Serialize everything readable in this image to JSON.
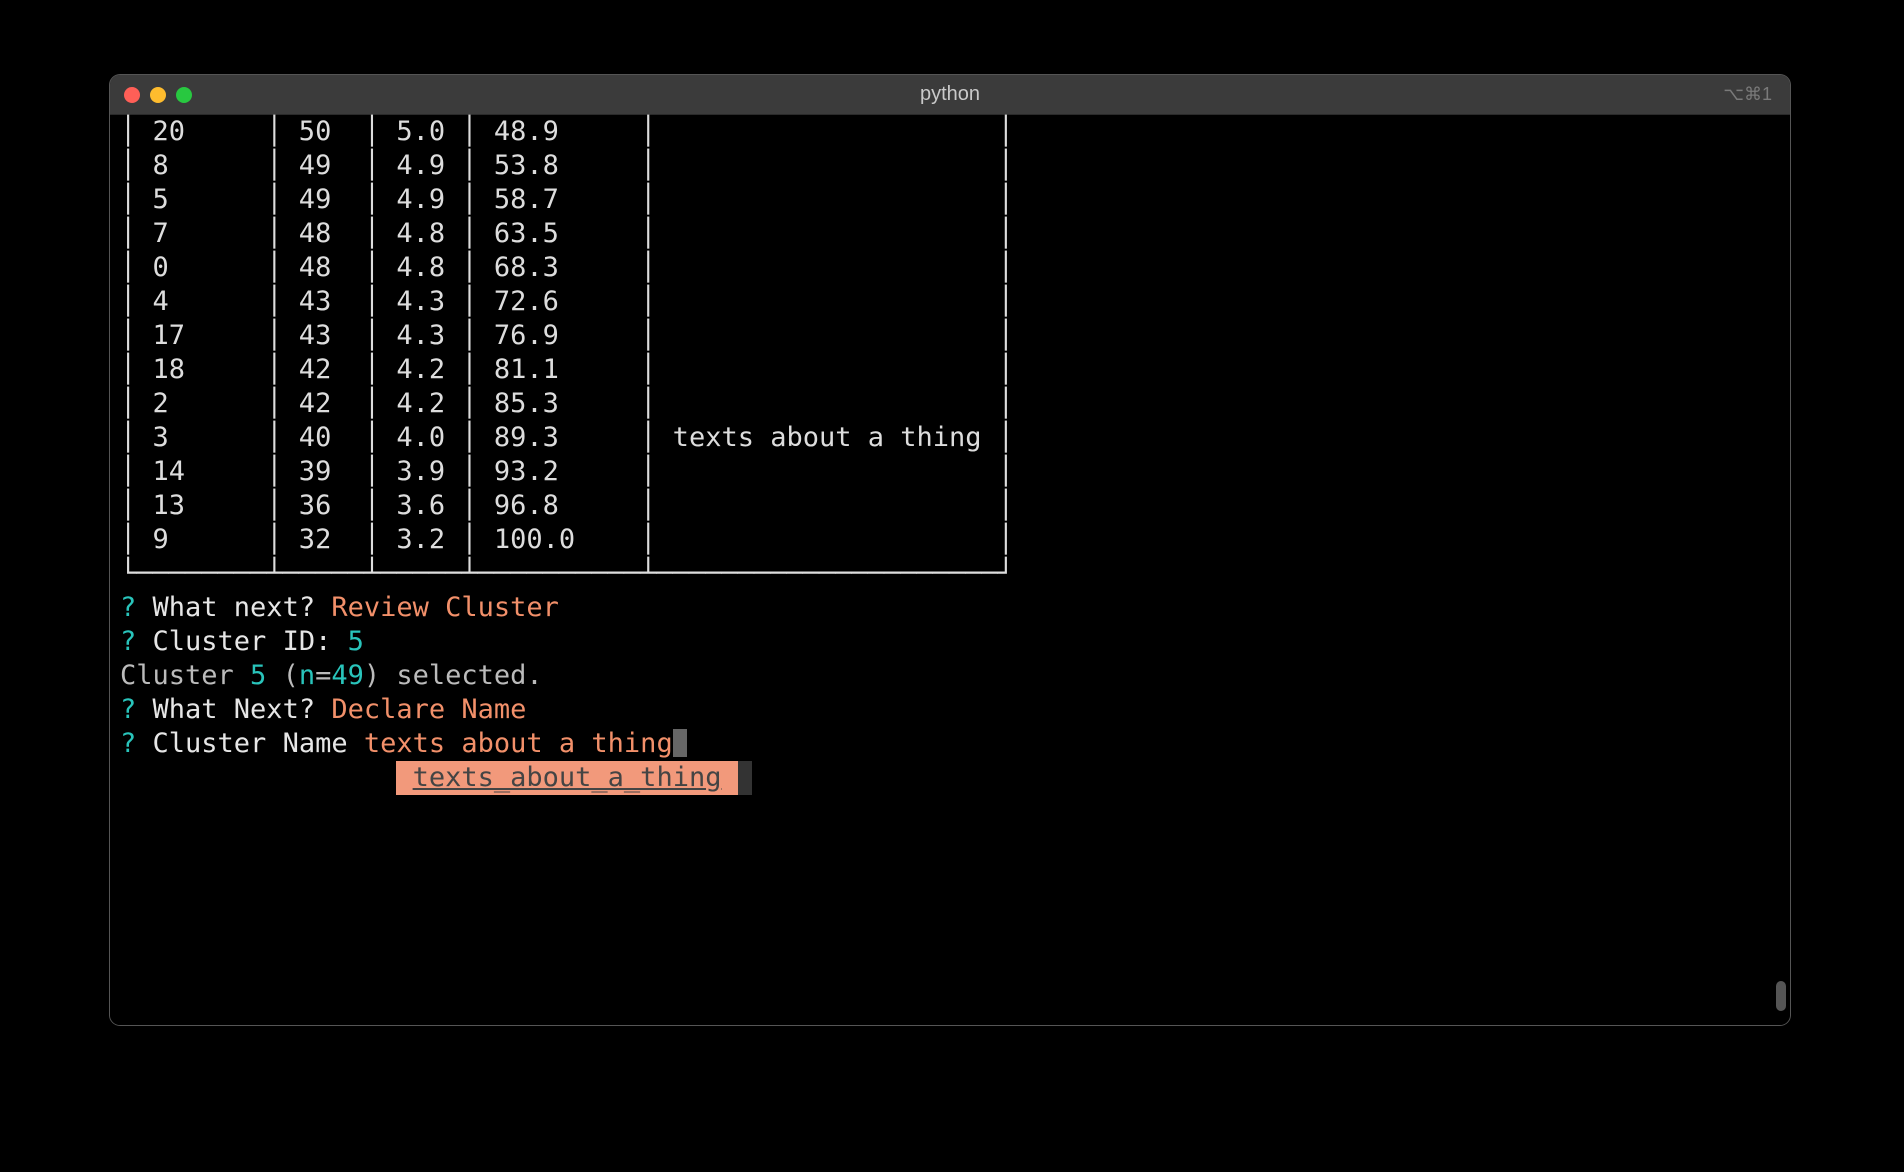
{
  "window": {
    "title": "python",
    "right_hint": "⌥⌘1"
  },
  "table": {
    "rows": [
      {
        "id": "20",
        "c2": "50",
        "c3": "5.0",
        "c4": "48.9",
        "desc": ""
      },
      {
        "id": "8",
        "c2": "49",
        "c3": "4.9",
        "c4": "53.8",
        "desc": ""
      },
      {
        "id": "5",
        "c2": "49",
        "c3": "4.9",
        "c4": "58.7",
        "desc": ""
      },
      {
        "id": "7",
        "c2": "48",
        "c3": "4.8",
        "c4": "63.5",
        "desc": ""
      },
      {
        "id": "0",
        "c2": "48",
        "c3": "4.8",
        "c4": "68.3",
        "desc": ""
      },
      {
        "id": "4",
        "c2": "43",
        "c3": "4.3",
        "c4": "72.6",
        "desc": ""
      },
      {
        "id": "17",
        "c2": "43",
        "c3": "4.3",
        "c4": "76.9",
        "desc": ""
      },
      {
        "id": "18",
        "c2": "42",
        "c3": "4.2",
        "c4": "81.1",
        "desc": ""
      },
      {
        "id": "2",
        "c2": "42",
        "c3": "4.2",
        "c4": "85.3",
        "desc": ""
      },
      {
        "id": "3",
        "c2": "40",
        "c3": "4.0",
        "c4": "89.3",
        "desc": "texts about a thing"
      },
      {
        "id": "14",
        "c2": "39",
        "c3": "3.9",
        "c4": "93.2",
        "desc": ""
      },
      {
        "id": "13",
        "c2": "36",
        "c3": "3.6",
        "c4": "96.8",
        "desc": ""
      },
      {
        "id": "9",
        "c2": "32",
        "c3": "3.2",
        "c4": "100.0",
        "desc": ""
      }
    ]
  },
  "prompts": {
    "q": "?",
    "what_next_1": " What next? ",
    "review_cluster": "Review Cluster",
    "cluster_id_label": " Cluster ID: ",
    "cluster_id_val": "5",
    "selected_prefix": "Cluster ",
    "selected_num": "5",
    "selected_paren_open": " (",
    "selected_nlabel": "n",
    "selected_eq": "=",
    "selected_nval": "49",
    "selected_close": ") selected.",
    "what_next_2": " What Next? ",
    "declare_name": "Declare Name",
    "cluster_name_label": " Cluster Name ",
    "cluster_name_val": "texts about a thing",
    "autocomplete": "texts_about_a_thing"
  }
}
